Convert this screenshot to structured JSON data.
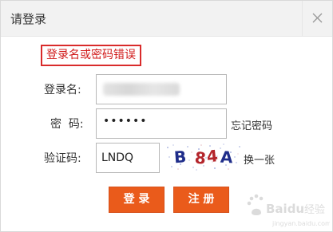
{
  "dialog": {
    "title": "请登录",
    "error_message": "登录名或密码错误"
  },
  "form": {
    "username_label": "登录名:",
    "password_label": "密  码:",
    "password_value": "••••••",
    "forgot_password": "忘记密码",
    "captcha_label": "验证码:",
    "captcha_value": "LNDQ",
    "captcha_image_text": "B84A",
    "refresh_captcha": "换一张"
  },
  "buttons": {
    "login": "登 录",
    "register": "注 册"
  },
  "watermark": {
    "text": "Baidu经验",
    "url": "jingyan.baidu.com"
  },
  "colors": {
    "accent": "#ea5b1b",
    "error": "#d11a1a"
  }
}
